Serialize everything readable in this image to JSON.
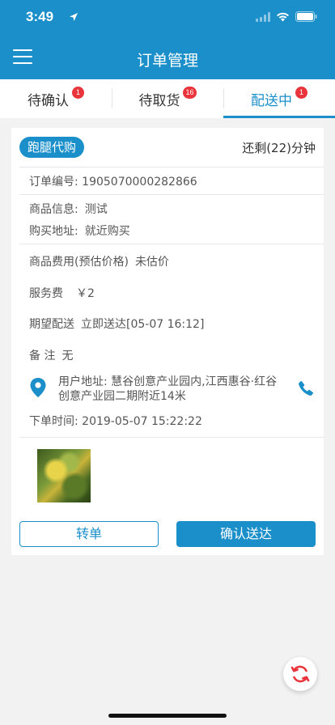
{
  "status_bar": {
    "time": "3:49"
  },
  "nav": {
    "title": "订单管理"
  },
  "tabs": [
    {
      "label": "待确认",
      "badge": "1",
      "active": false
    },
    {
      "label": "待取货",
      "badge": "16",
      "active": false
    },
    {
      "label": "配送中",
      "badge": "1",
      "active": true
    }
  ],
  "order": {
    "tag": "跑腿代购",
    "remaining": "还剩(22)分钟",
    "order_no_label": "订单编号:",
    "order_no": "1905070000282866",
    "goods_info_label": "商品信息:",
    "goods_info": "测试",
    "buy_addr_label": "购买地址:",
    "buy_addr": "就近购买",
    "goods_fee_label": "商品费用(预估价格)",
    "goods_fee": "未估价",
    "service_fee_label": "服务费",
    "service_fee": "￥2",
    "expect_label": "期望配送",
    "expect": "立即送达[05-07 16:12]",
    "remark_label": "备 注",
    "remark": "无",
    "user_addr_label": "用户地址:",
    "user_addr": "慧谷创意产业园内,江西惠谷·红谷创意产业园二期附近14米",
    "order_time_label": "下单时间:",
    "order_time": "2019-05-07 15:22:22"
  },
  "actions": {
    "transfer": "转单",
    "confirm": "确认送达"
  },
  "colors": {
    "primary": "#1a8fc9",
    "badge": "#e8343a",
    "refresh": "#e8343a"
  },
  "icons": [
    "menu-icon",
    "location-pin-icon",
    "phone-icon",
    "refresh-icon",
    "wifi-icon",
    "battery-icon",
    "signal-icon",
    "location-arrow-icon"
  ]
}
